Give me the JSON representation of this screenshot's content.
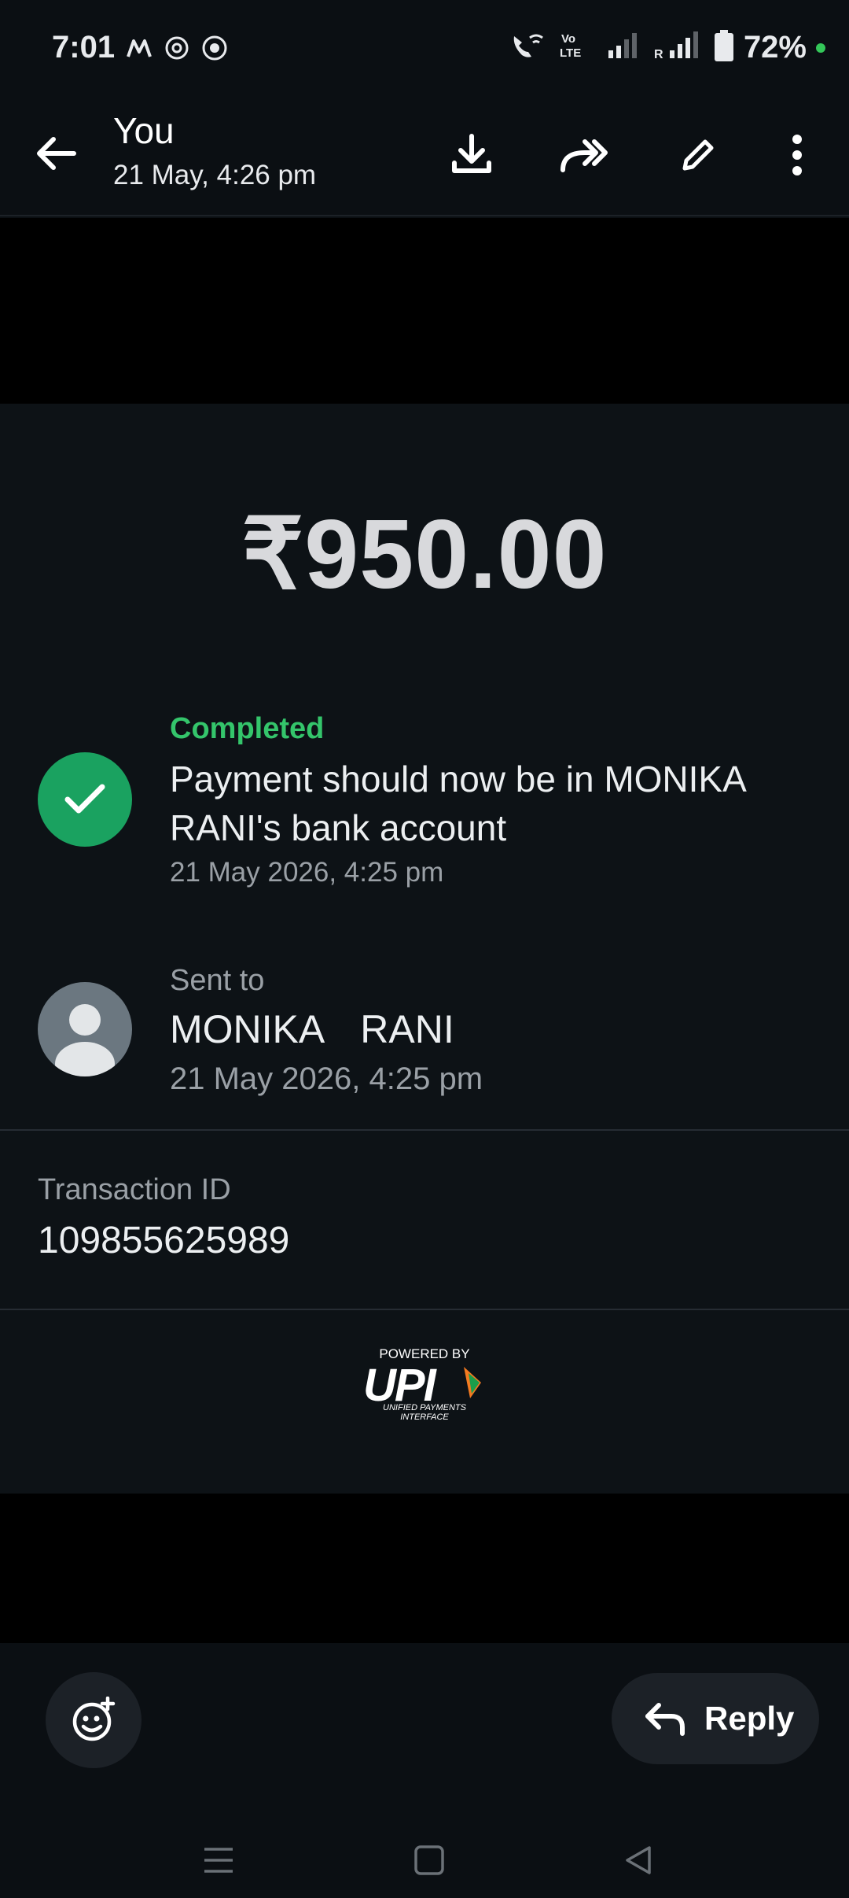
{
  "status_bar": {
    "time": "7:01",
    "battery": "72%",
    "app_icons": [
      "m-icon",
      "threads-icon",
      "chrome-icon"
    ]
  },
  "header": {
    "title": "You",
    "subtitle": "21 May, 4:26 pm",
    "actions": [
      "download-icon",
      "forward-icon",
      "edit-icon",
      "more-icon"
    ]
  },
  "payment": {
    "amount": "₹950.00",
    "status_label": "Completed",
    "status_message": "Payment should now be in MONIKA RANI's bank account",
    "status_time": "21 May 2026, 4:25 pm",
    "sent_to_label": "Sent to",
    "recipient_name": "MONIKA  RANI",
    "sent_time": "21 May 2026, 4:25 pm",
    "transaction_id_label": "Transaction ID",
    "transaction_id": "109855625989"
  },
  "upi": {
    "powered_by": "POWERED BY",
    "wordmark": "UPI",
    "tagline": "UNIFIED PAYMENTS INTERFACE"
  },
  "bottom": {
    "reply_label": "Reply"
  },
  "colors": {
    "background": "#0b0f13",
    "card": "#0d1216",
    "success": "#1aa260",
    "success_text": "#34c56b"
  }
}
